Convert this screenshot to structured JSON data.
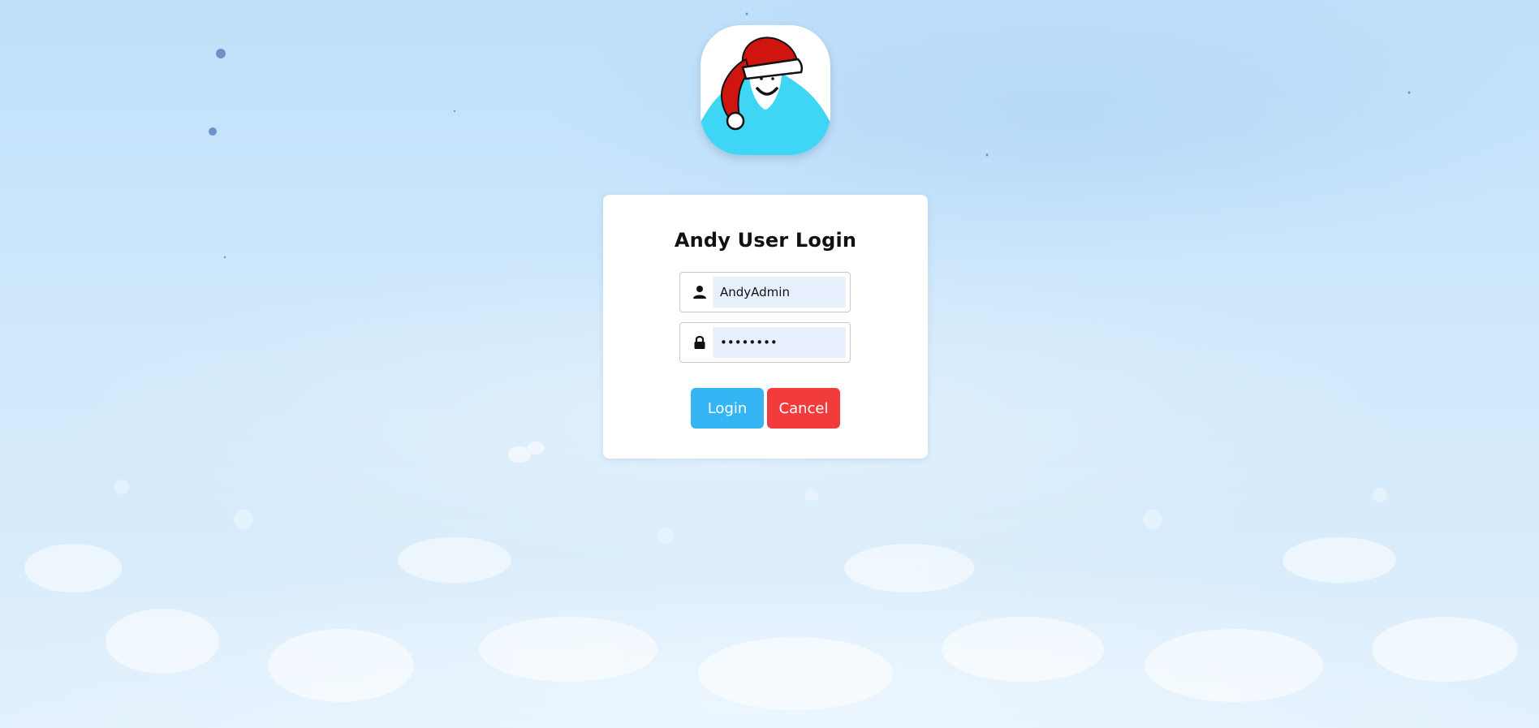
{
  "login": {
    "title": "Andy User Login",
    "username_value": "AndyAdmin",
    "password_value": "password",
    "login_label": "Login",
    "cancel_label": "Cancel"
  },
  "icons": {
    "username": "user-icon",
    "password": "lock-icon",
    "logo": "santa-hat-avatar-logo"
  },
  "colors": {
    "login_button": "#36b5f5",
    "cancel_button": "#f23c3c",
    "avatar_body": "#3fd6f5",
    "hat": "#d0140f"
  }
}
